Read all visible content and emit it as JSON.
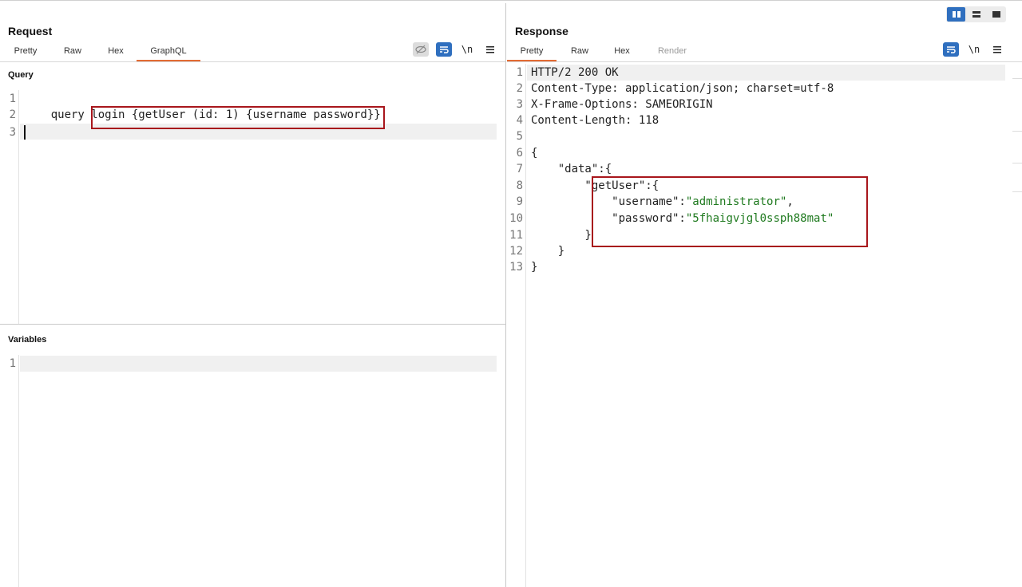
{
  "layout_toggle": {
    "options": [
      "side-by-side",
      "stacked",
      "single"
    ],
    "active": "side-by-side"
  },
  "request": {
    "title": "Request",
    "tabs": [
      {
        "label": "Pretty",
        "active": false
      },
      {
        "label": "Raw",
        "active": false
      },
      {
        "label": "Hex",
        "active": false
      },
      {
        "label": "GraphQL",
        "active": true
      }
    ],
    "tools": {
      "newline_label": "\\n"
    },
    "query_label": "Query",
    "query_lines": [
      {
        "num": "1",
        "code": ""
      },
      {
        "num": "2",
        "code": "    query login {getUser (id: 1) {username password}}"
      },
      {
        "num": "3",
        "code": ""
      }
    ],
    "variables_label": "Variables",
    "variables_lines": [
      {
        "num": "1",
        "code": ""
      }
    ]
  },
  "response": {
    "title": "Response",
    "tabs": [
      {
        "label": "Pretty",
        "active": true
      },
      {
        "label": "Raw",
        "active": false
      },
      {
        "label": "Hex",
        "active": false
      },
      {
        "label": "Render",
        "active": false,
        "disabled": true
      }
    ],
    "tools": {
      "newline_label": "\\n"
    },
    "lines": [
      {
        "num": "1",
        "code": "HTTP/2 200 OK"
      },
      {
        "num": "2",
        "code": "Content-Type: application/json; charset=utf-8"
      },
      {
        "num": "3",
        "code": "X-Frame-Options: SAMEORIGIN"
      },
      {
        "num": "4",
        "code": "Content-Length: 118"
      },
      {
        "num": "5",
        "code": ""
      },
      {
        "num": "6",
        "code": "{"
      },
      {
        "num": "7",
        "code": "    \"data\":{"
      },
      {
        "num": "8",
        "code": "        \"getUser\":{"
      },
      {
        "num": "9",
        "key": "            \"username\":",
        "value": "\"administrator\"",
        "tail": ","
      },
      {
        "num": "10",
        "key": "            \"password\":",
        "value": "\"5fhaigvjgl0ssph88mat\"",
        "tail": ""
      },
      {
        "num": "11",
        "code": "        }"
      },
      {
        "num": "12",
        "code": "    }"
      },
      {
        "num": "13",
        "code": "}"
      }
    ]
  },
  "colors": {
    "accent_tab": "#e36a33",
    "highlight_box": "#a8161c",
    "string_value": "#1f7a1f",
    "toggle_active": "#2f6fbf"
  }
}
